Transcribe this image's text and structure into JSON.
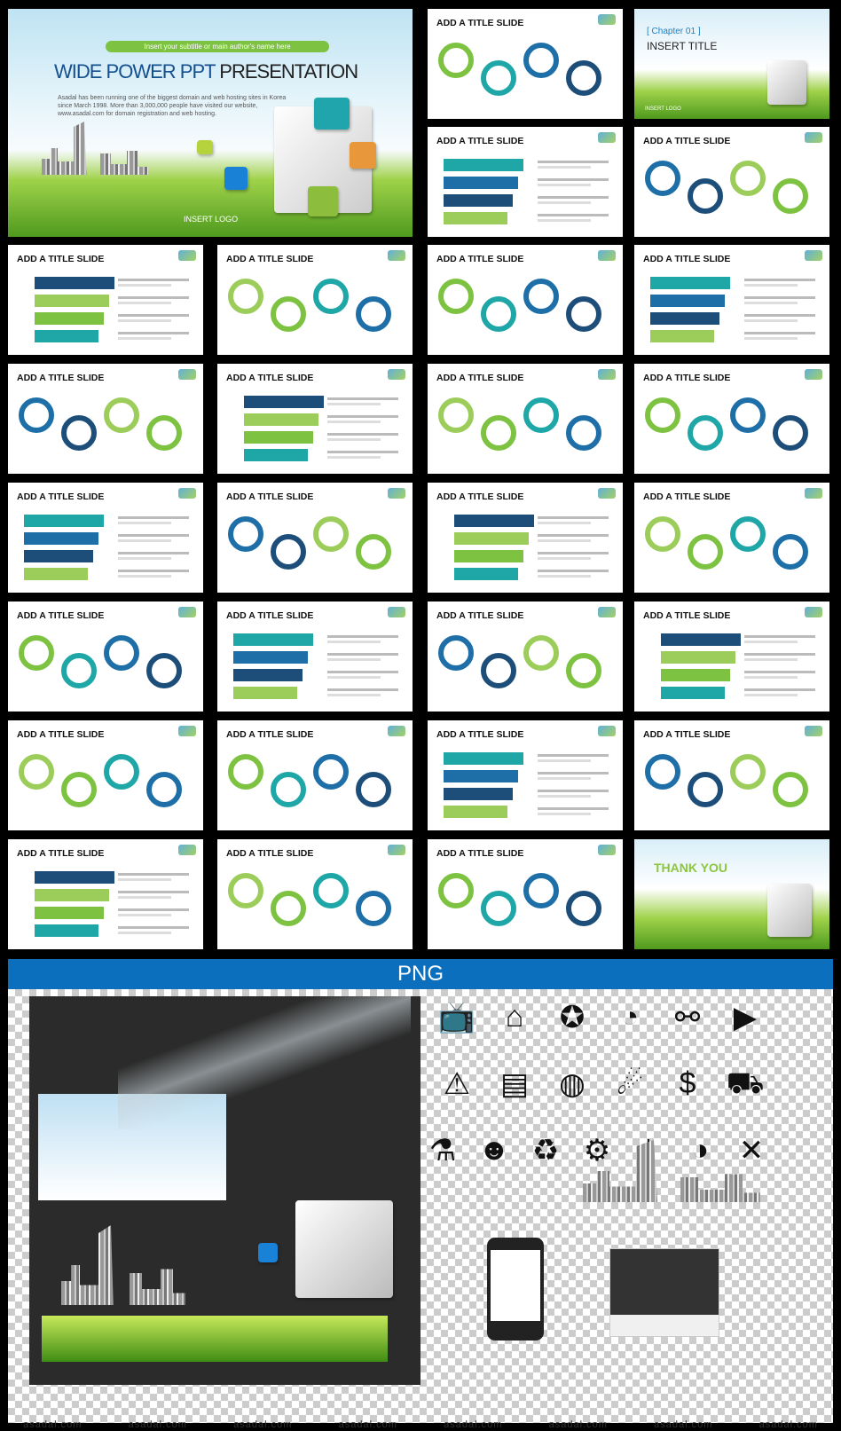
{
  "hero": {
    "subtitle": "Insert your subtitle or main author's name here",
    "title_blue": "WIDE POWER PPT",
    "title_dark": "PRESENTATION",
    "description": "Asadal has been running one of the biggest domain and web hosting sites in Korea since March 1998. More than 3,000,000 people have visited our website, www.asadal.com for domain registration and web hosting.",
    "logo": "INSERT LOGO"
  },
  "chapter": {
    "label": "[ Chapter 01 ]",
    "title": "INSERT TITLE",
    "logo": "INSERT LOGO"
  },
  "slide_title": "ADD A TITLE SLIDE",
  "thank_you": "THANK YOU",
  "thumb_styles": [
    "steps",
    "steps",
    "ribbon",
    "tabs",
    "gauge",
    "network",
    "phones",
    "bars",
    "hex",
    "cubes",
    "arrows",
    "arrow",
    "zigzag",
    "circles",
    "folder",
    "star",
    "stack",
    "quad",
    "donuts",
    "diag",
    "atom",
    "linechart",
    "sliders",
    "cart",
    "monitor",
    "steps4",
    "map"
  ],
  "png_header": "PNG",
  "icons": [
    "tv-icon",
    "home-icon",
    "award-icon",
    "rss-icon",
    "share-icon",
    "video-icon",
    "warning-icon",
    "battery-icon",
    "globe-icon",
    "satellite-icon",
    "money-bag-icon",
    "cart-icon",
    "flask-add-icon",
    "user-add-icon",
    "recycle-icon",
    "gears-icon",
    "download-icon",
    "mouse-icon",
    "tools-icon"
  ],
  "watermark": "asadal.com",
  "colors": {
    "green": "#7dc241",
    "teal": "#1fa6a6",
    "blue": "#1e6fa8",
    "navy": "#1d4e79",
    "band": "#0b6fbd"
  }
}
